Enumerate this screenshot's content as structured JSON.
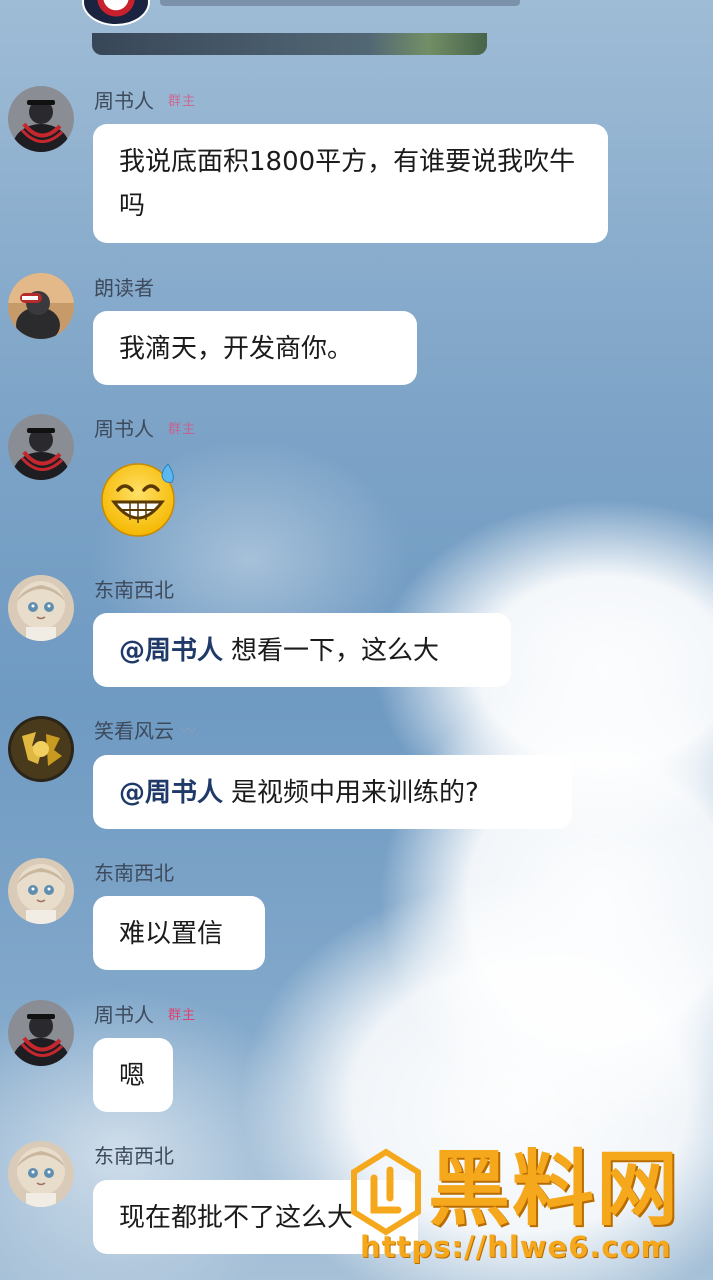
{
  "messages": [
    {
      "sender": "周书人",
      "role": "群主",
      "text": "我说底面积1800平方，有谁要说我吹牛吗"
    },
    {
      "sender": "朗读者",
      "text": "我滴天，开发商你。"
    },
    {
      "sender": "周书人",
      "role": "群主",
      "sticker": "grinning-sweat-emoji"
    },
    {
      "sender": "东南西北",
      "mention": "@周书人",
      "text": "想看一下，这么大"
    },
    {
      "sender": "笑看风云",
      "mention": "@周书人",
      "text": "是视频中用来训练的?"
    },
    {
      "sender": "东南西北",
      "text": "难以置信"
    },
    {
      "sender": "周书人",
      "role": "群主",
      "text": "嗯"
    },
    {
      "sender": "东南西北",
      "text": "现在都批不了这么大"
    }
  ],
  "watermark": {
    "title": "黑料网",
    "url": "https://hlwe6.com"
  },
  "colors": {
    "bubble": "#ffffff",
    "sender_name": "#3d4a5c",
    "owner_badge": "#e33d6d",
    "mention": "#1f3a68",
    "watermark": "#f6a81d",
    "sky": "#6f9ac2"
  }
}
